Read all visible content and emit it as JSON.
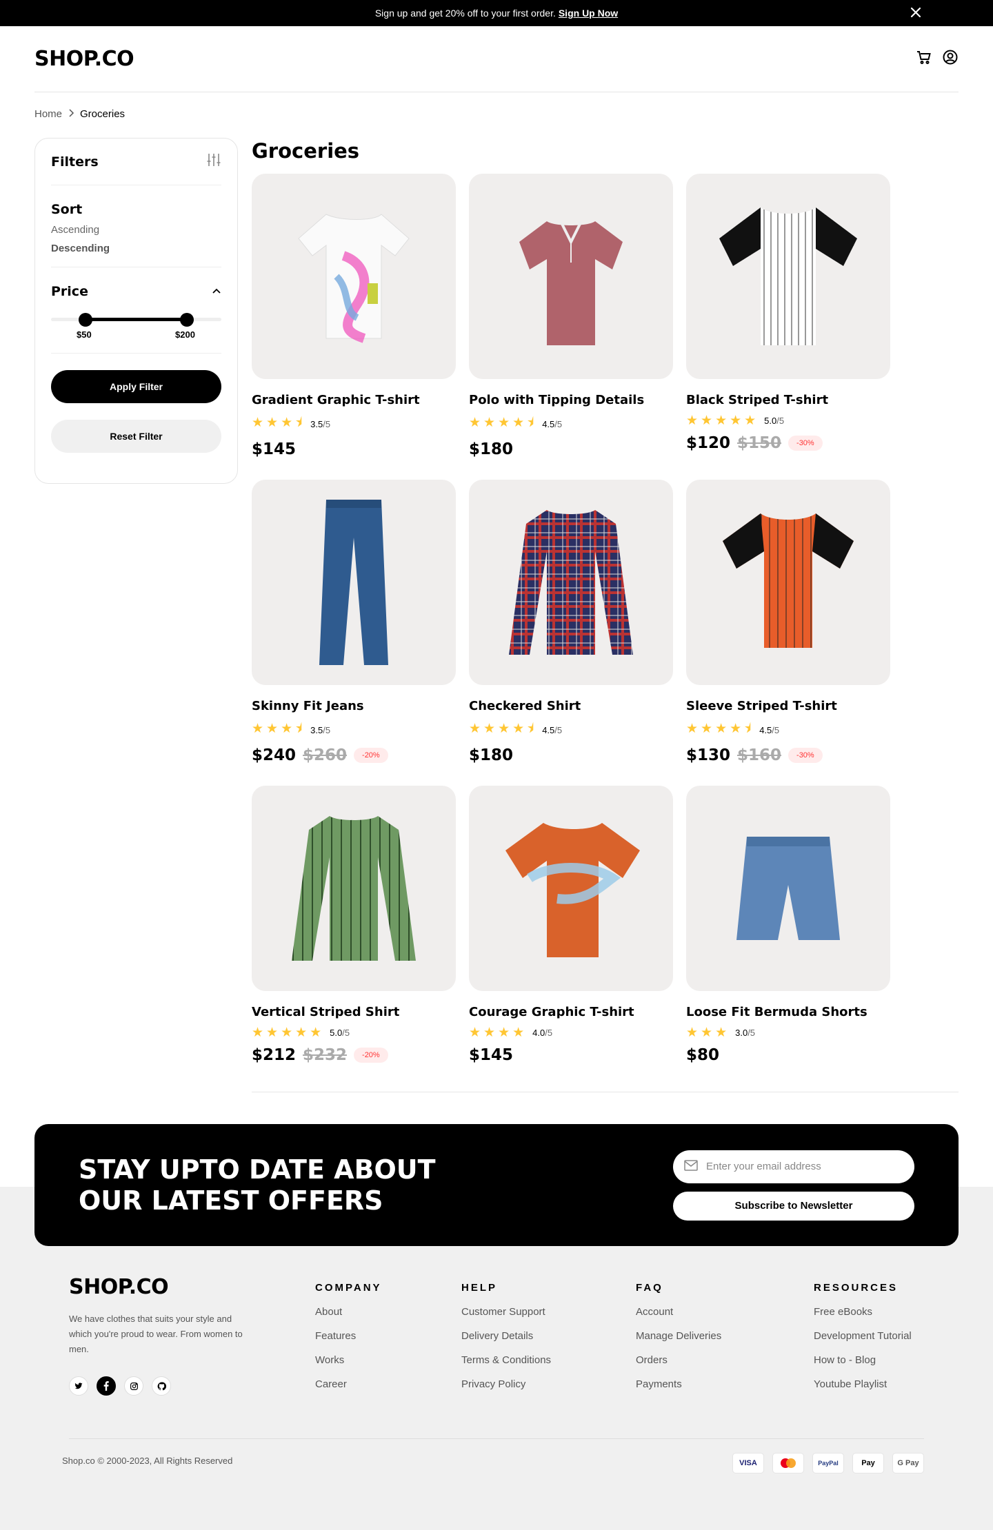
{
  "promo": {
    "text": "Sign up and get 20% off to your first order.",
    "cta": "Sign Up Now"
  },
  "header": {
    "logo": "SHOP.CO"
  },
  "breadcrumb": {
    "home": "Home",
    "current": "Groceries"
  },
  "filters": {
    "title": "Filters",
    "sort_title": "Sort",
    "sort_options": [
      "Ascending",
      "Descending"
    ],
    "sort_selected": "Descending",
    "price_title": "Price",
    "price_min": "$50",
    "price_max": "$200",
    "apply": "Apply Filter",
    "reset": "Reset Filter"
  },
  "page_title": "Groceries",
  "products": [
    {
      "name": "Gradient Graphic T-shirt",
      "rating": "3.5",
      "stars": "★★★⯨",
      "of": "/5",
      "price": "$145",
      "old": "",
      "discount": ""
    },
    {
      "name": "Polo with Tipping Details",
      "rating": "4.5",
      "stars": "★★★★⯨",
      "of": "/5",
      "price": "$180",
      "old": "",
      "discount": ""
    },
    {
      "name": "Black Striped T-shirt",
      "rating": "5.0",
      "stars": "★★★★★",
      "of": "/5",
      "price": "$120",
      "old": "$150",
      "discount": "-30%"
    },
    {
      "name": "Skinny Fit Jeans",
      "rating": "3.5",
      "stars": "★★★⯨",
      "of": "/5",
      "price": "$240",
      "old": "$260",
      "discount": "-20%"
    },
    {
      "name": "Checkered Shirt",
      "rating": "4.5",
      "stars": "★★★★⯨",
      "of": "/5",
      "price": "$180",
      "old": "",
      "discount": ""
    },
    {
      "name": "Sleeve Striped T-shirt",
      "rating": "4.5",
      "stars": "★★★★⯨",
      "of": "/5",
      "price": "$130",
      "old": "$160",
      "discount": "-30%"
    },
    {
      "name": "Vertical Striped Shirt",
      "rating": "5.0",
      "stars": "★★★★★",
      "of": "/5",
      "price": "$212",
      "old": "$232",
      "discount": "-20%"
    },
    {
      "name": "Courage Graphic T-shirt",
      "rating": "4.0",
      "stars": "★★★★",
      "of": "/5",
      "price": "$145",
      "old": "",
      "discount": ""
    },
    {
      "name": "Loose Fit Bermuda Shorts",
      "rating": "3.0",
      "stars": "★★★",
      "of": "/5",
      "price": "$80",
      "old": "",
      "discount": ""
    }
  ],
  "newsletter": {
    "title": "STAY UPTO DATE ABOUT OUR LATEST OFFERS",
    "placeholder": "Enter your email address",
    "button": "Subscribe to Newsletter"
  },
  "footer": {
    "logo": "SHOP.CO",
    "tagline": "We have clothes that suits your style and which you're proud to wear. From women to men.",
    "columns": [
      {
        "title": "COMPANY",
        "links": [
          "About",
          "Features",
          "Works",
          "Career"
        ]
      },
      {
        "title": "HELP",
        "links": [
          "Customer Support",
          "Delivery Details",
          "Terms & Conditions",
          "Privacy Policy"
        ]
      },
      {
        "title": "FAQ",
        "links": [
          "Account",
          "Manage Deliveries",
          "Orders",
          "Payments"
        ]
      },
      {
        "title": "RESOURCES",
        "links": [
          "Free eBooks",
          "Development Tutorial",
          "How to - Blog",
          "Youtube Playlist"
        ]
      }
    ],
    "copyright": "Shop.co © 2000-2023, All Rights Reserved",
    "payments": [
      "VISA",
      "mastercard",
      "PayPal",
      "Pay",
      "G Pay"
    ]
  },
  "colors": {
    "star": "#FFC633",
    "discount": "#FF3333",
    "card_bg": "#F0EEED"
  }
}
